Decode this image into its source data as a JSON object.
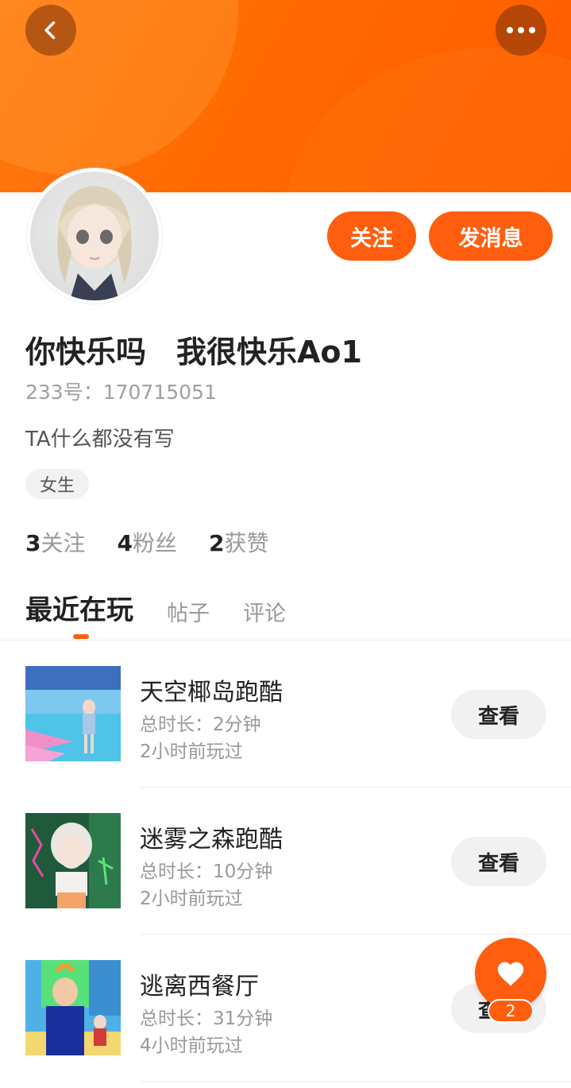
{
  "header": {
    "back_icon": "chevron-left-icon",
    "more_icon": "more-horizontal-icon",
    "banner_color": "#ff6a00"
  },
  "profile": {
    "username": "你快乐吗　我很快乐Ao1",
    "id_text": "233号：170715051",
    "bio": "TA什么都没有写",
    "gender": "女生",
    "follow_label": "关注",
    "message_label": "发消息"
  },
  "stats": [
    {
      "num": "3",
      "label": "关注"
    },
    {
      "num": "4",
      "label": "粉丝"
    },
    {
      "num": "2",
      "label": "获赞"
    }
  ],
  "tabs": [
    {
      "label": "最近在玩",
      "active": true
    },
    {
      "label": "帖子",
      "active": false
    },
    {
      "label": "评论",
      "active": false
    }
  ],
  "games": [
    {
      "name": "天空椰岛跑酷",
      "duration": "总时长：2分钟",
      "last_played": "2小时前玩过",
      "button": "查看"
    },
    {
      "name": "迷雾之森跑酷",
      "duration": "总时长：10分钟",
      "last_played": "2小时前玩过",
      "button": "查看"
    },
    {
      "name": "逃离西餐厅",
      "duration": "总时长：31分钟",
      "last_played": "4小时前玩过",
      "button": "查看"
    }
  ],
  "fab": {
    "icon": "heart-icon",
    "badge": "2"
  },
  "colors": {
    "accent": "#ff5e0e",
    "muted_text": "#999999"
  }
}
